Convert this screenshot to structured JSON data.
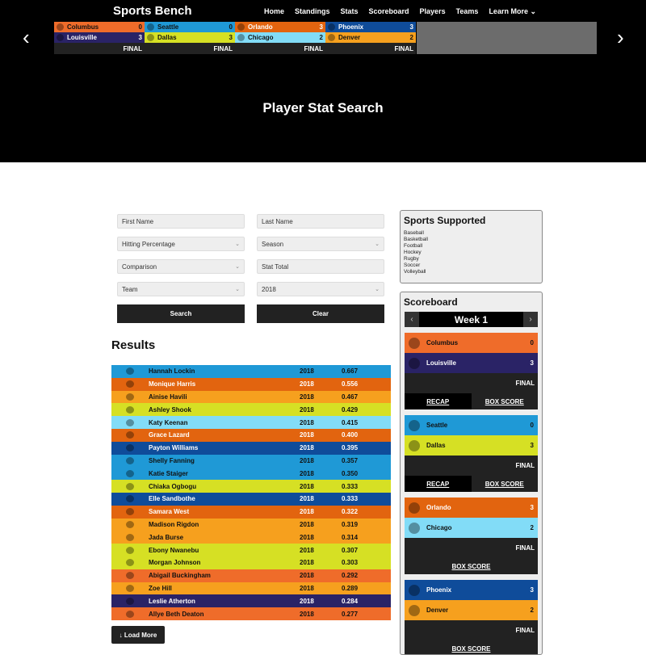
{
  "brand": "Sports Bench",
  "nav": [
    "Home",
    "Standings",
    "Stats",
    "Scoreboard",
    "Players",
    "Teams",
    "Learn More ⌄"
  ],
  "ticker": [
    {
      "away": {
        "name": "Columbus",
        "score": "0",
        "bg": "#ef6c2a",
        "fg": "#111"
      },
      "home": {
        "name": "Louisville",
        "score": "3",
        "bg": "#2a2366",
        "fg": "#fff"
      },
      "status": "FINAL"
    },
    {
      "away": {
        "name": "Seattle",
        "score": "0",
        "bg": "#1f99d6",
        "fg": "#111"
      },
      "home": {
        "name": "Dallas",
        "score": "3",
        "bg": "#d6e024",
        "fg": "#111"
      },
      "status": "FINAL"
    },
    {
      "away": {
        "name": "Orlando",
        "score": "3",
        "bg": "#e2640f",
        "fg": "#fff"
      },
      "home": {
        "name": "Chicago",
        "score": "2",
        "bg": "#82dcf7",
        "fg": "#111"
      },
      "status": "FINAL"
    },
    {
      "away": {
        "name": "Phoenix",
        "score": "3",
        "bg": "#0f4c9a",
        "fg": "#fff"
      },
      "home": {
        "name": "Denver",
        "score": "2",
        "bg": "#f6a01e",
        "fg": "#111"
      },
      "status": "FINAL"
    }
  ],
  "page_title": "Player Stat Search",
  "form": {
    "first_name": "First Name",
    "last_name": "Last Name",
    "stat": "Hitting Percentage",
    "season": "Season",
    "comparison": "Comparison",
    "stat_total": "Stat Total",
    "team": "Team",
    "year": "2018",
    "search": "Search",
    "clear": "Clear"
  },
  "results_title": "Results",
  "results": [
    {
      "name": "Hannah Lockin",
      "year": "2018",
      "value": "0.667",
      "bg": "#1f99d6",
      "fg": "#111"
    },
    {
      "name": "Monique Harris",
      "year": "2018",
      "value": "0.556",
      "bg": "#e2640f",
      "fg": "#fff"
    },
    {
      "name": "Ainise Havili",
      "year": "2018",
      "value": "0.467",
      "bg": "#f6a01e",
      "fg": "#111"
    },
    {
      "name": "Ashley Shook",
      "year": "2018",
      "value": "0.429",
      "bg": "#d6e024",
      "fg": "#111"
    },
    {
      "name": "Katy Keenan",
      "year": "2018",
      "value": "0.415",
      "bg": "#82dcf7",
      "fg": "#111"
    },
    {
      "name": "Grace Lazard",
      "year": "2018",
      "value": "0.400",
      "bg": "#e2640f",
      "fg": "#fff"
    },
    {
      "name": "Payton Williams",
      "year": "2018",
      "value": "0.395",
      "bg": "#0f4c9a",
      "fg": "#fff"
    },
    {
      "name": "Shelly Fanning",
      "year": "2018",
      "value": "0.357",
      "bg": "#1f99d6",
      "fg": "#111"
    },
    {
      "name": "Katie Staiger",
      "year": "2018",
      "value": "0.350",
      "bg": "#1f99d6",
      "fg": "#111"
    },
    {
      "name": "Chiaka Ogbogu",
      "year": "2018",
      "value": "0.333",
      "bg": "#d6e024",
      "fg": "#111"
    },
    {
      "name": "Elle Sandbothe",
      "year": "2018",
      "value": "0.333",
      "bg": "#0f4c9a",
      "fg": "#fff"
    },
    {
      "name": "Samara West",
      "year": "2018",
      "value": "0.322",
      "bg": "#e2640f",
      "fg": "#fff"
    },
    {
      "name": "Madison Rigdon",
      "year": "2018",
      "value": "0.319",
      "bg": "#f6a01e",
      "fg": "#111"
    },
    {
      "name": "Jada Burse",
      "year": "2018",
      "value": "0.314",
      "bg": "#f6a01e",
      "fg": "#111"
    },
    {
      "name": "Ebony Nwanebu",
      "year": "2018",
      "value": "0.307",
      "bg": "#d6e024",
      "fg": "#111"
    },
    {
      "name": "Morgan Johnson",
      "year": "2018",
      "value": "0.303",
      "bg": "#d6e024",
      "fg": "#111"
    },
    {
      "name": "Abigail Buckingham",
      "year": "2018",
      "value": "0.292",
      "bg": "#ef6c2a",
      "fg": "#111"
    },
    {
      "name": "Zoe Hill",
      "year": "2018",
      "value": "0.289",
      "bg": "#f6a01e",
      "fg": "#111"
    },
    {
      "name": "Leslie Atherton",
      "year": "2018",
      "value": "0.284",
      "bg": "#2a2366",
      "fg": "#fff"
    },
    {
      "name": "Allye Beth Deaton",
      "year": "2018",
      "value": "0.277",
      "bg": "#ef6c2a",
      "fg": "#111"
    }
  ],
  "load_more": "↓ Load More",
  "sports_panel": {
    "title": "Sports Supported",
    "items": [
      "Baseball",
      "Basketball",
      "Football",
      "Hockey",
      "Rugby",
      "Soccer",
      "Volleyball"
    ]
  },
  "scoreboard": {
    "title": "Scoreboard",
    "week": "Week 1",
    "prev": "‹",
    "next": "›",
    "recap": "RECAP",
    "box": "BOX SCORE"
  }
}
